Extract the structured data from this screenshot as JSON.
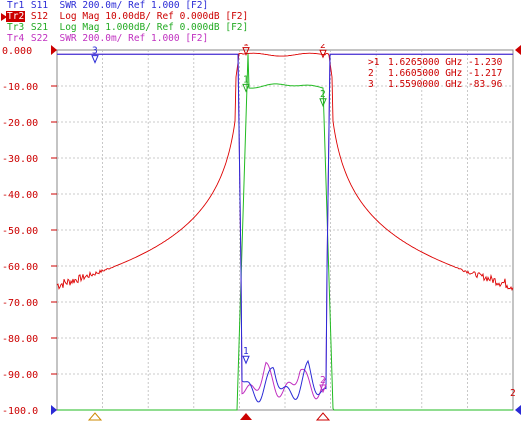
{
  "traces": [
    {
      "name": "Tr1",
      "text": "S11  SWR 200.0m/ Ref 1.000 [F2]",
      "color": "#2b2bd6",
      "active": false
    },
    {
      "name": "Tr2",
      "text": "S12  Log Mag 10.00dB/ Ref 0.000dB [F2]",
      "color": "#cc0000",
      "active": true
    },
    {
      "name": "Tr3",
      "text": "S21  Log Mag 1.000dB/ Ref 0.000dB [F2]",
      "color": "#22aa22",
      "active": false
    },
    {
      "name": "Tr4",
      "text": "S22  SWR 200.0m/ Ref 1.000 [F2]",
      "color": "#c030c0",
      "active": false
    }
  ],
  "y_labels": [
    "0.000",
    "-10.00",
    "-20.00",
    "-30.00",
    "-40.00",
    "-50.00",
    "-60.00",
    "-70.00",
    "-80.00",
    "-90.00",
    "-100.0"
  ],
  "marker_table": [
    {
      "id": ">1",
      "freq": "1.6265000 GHz",
      "value": "-1.230"
    },
    {
      "id": "2",
      "freq": "1.6605000 GHz",
      "value": "-1.217"
    },
    {
      "id": "3",
      "freq": "1.5590000 GHz",
      "value": "-83.96"
    }
  ],
  "marker_labels": {
    "m1": "1",
    "m2": "2",
    "m3": "3",
    "right_edge": "2"
  },
  "chart_data": {
    "type": "line",
    "ylim": [
      -100,
      0
    ],
    "y_divisions": 10,
    "grid": true,
    "series": [
      {
        "name": "S11",
        "color": "#2b2bd6"
      },
      {
        "name": "S12",
        "color": "#cc0000"
      },
      {
        "name": "S21",
        "color": "#22aa22"
      },
      {
        "name": "S22",
        "color": "#c030c0"
      }
    ]
  }
}
